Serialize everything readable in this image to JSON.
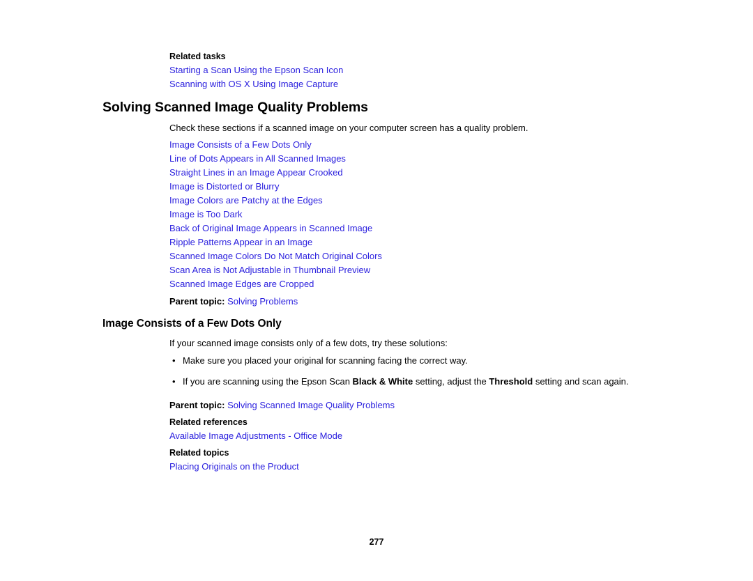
{
  "document": {
    "page_number": "277",
    "link_color": "#2b20de",
    "text_color": "#000000",
    "background_color": "#ffffff"
  },
  "related_tasks": {
    "heading": "Related tasks",
    "links": [
      "Starting a Scan Using the Epson Scan Icon",
      "Scanning with OS X Using Image Capture"
    ]
  },
  "section_quality": {
    "title": "Solving Scanned Image Quality Problems",
    "intro": "Check these sections if a scanned image on your computer screen has a quality problem.",
    "links": [
      "Image Consists of a Few Dots Only",
      "Line of Dots Appears in All Scanned Images",
      "Straight Lines in an Image Appear Crooked",
      "Image is Distorted or Blurry",
      "Image Colors are Patchy at the Edges",
      "Image is Too Dark",
      "Back of Original Image Appears in Scanned Image",
      "Ripple Patterns Appear in an Image",
      "Scanned Image Colors Do Not Match Original Colors",
      "Scan Area is Not Adjustable in Thumbnail Preview",
      "Scanned Image Edges are Cropped"
    ],
    "parent_topic_label": "Parent topic:",
    "parent_topic_link": "Solving Problems"
  },
  "section_dots": {
    "title": "Image Consists of a Few Dots Only",
    "intro": "If your scanned image consists only of a few dots, try these solutions:",
    "bullets": [
      {
        "bullet": "•",
        "parts": [
          {
            "text": "Make sure you placed your original for scanning facing the correct way.",
            "bold": false
          }
        ]
      },
      {
        "bullet": "•",
        "parts": [
          {
            "text": "If you are scanning using the Epson Scan ",
            "bold": false
          },
          {
            "text": "Black & White",
            "bold": true
          },
          {
            "text": " setting, adjust the ",
            "bold": false
          },
          {
            "text": "Threshold",
            "bold": true
          },
          {
            "text": " setting and scan again.",
            "bold": false
          }
        ]
      }
    ],
    "parent_topic_label": "Parent topic:",
    "parent_topic_link": "Solving Scanned Image Quality Problems",
    "related_references_heading": "Related references",
    "related_references_links": [
      "Available Image Adjustments - Office Mode"
    ],
    "related_topics_heading": "Related topics",
    "related_topics_links": [
      "Placing Originals on the Product"
    ]
  }
}
